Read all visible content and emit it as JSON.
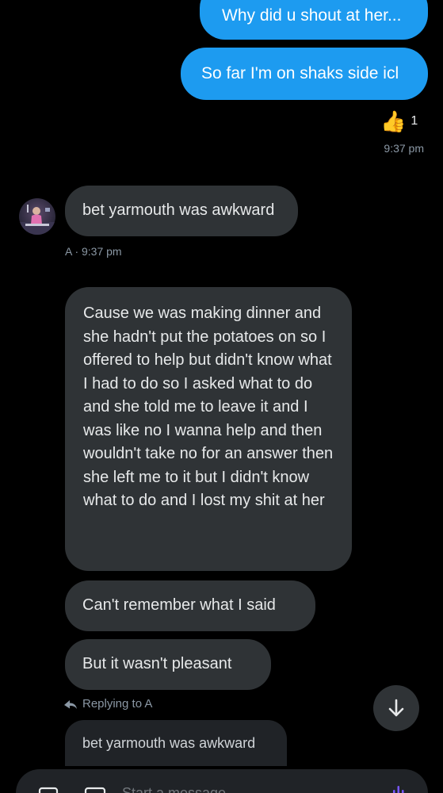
{
  "conversation": {
    "outgoing": [
      {
        "text": "Why did u shout at her..."
      },
      {
        "text": "So far I'm on shaks side icl"
      }
    ],
    "reaction": {
      "emoji": "👍",
      "count": "1"
    },
    "outgoing_time": "9:37 pm",
    "incoming_first": {
      "text": "bet yarmouth was awkward",
      "meta": "A · 9:37 pm"
    },
    "incoming": [
      {
        "text": "Cause we was making dinner and she hadn't put the potatoes on so I offered to help but didn't know what I had to do so I asked what to do and she told me to leave it and I was like no I wanna help and then wouldn't take no for an answer then she left me to it but I didn't know what to do and I lost my shit at her"
      },
      {
        "text": "Can't remember what I said"
      },
      {
        "text": "But it wasn't pleasant"
      }
    ],
    "reply": {
      "label": "Replying to A",
      "quoted": "bet yarmouth was awkward"
    }
  },
  "composer": {
    "placeholder": "Start a message"
  },
  "colors": {
    "outgoing_bubble": "#1d9bf0",
    "incoming_bubble": "#2f3336",
    "background": "#000000",
    "muted_text": "#8b98a5"
  },
  "icons": [
    "thumbs-up-icon",
    "reply-arrow-icon",
    "arrow-down-icon",
    "image-icon",
    "gif-icon",
    "voice-icon"
  ]
}
